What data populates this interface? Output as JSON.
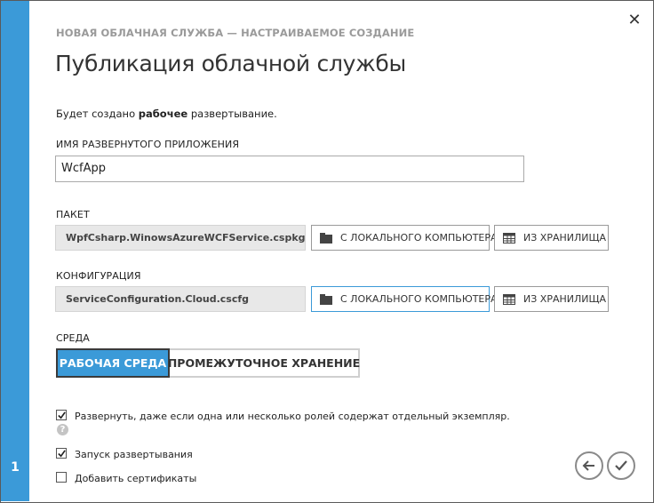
{
  "wizard": {
    "step": "1",
    "subtitle": "НОВАЯ ОБЛАЧНАЯ СЛУЖБА — НАСТРАИВАЕМОЕ СОЗДАНИЕ",
    "title": "Публикация облачной службы",
    "info_prefix": "Будет создано ",
    "info_bold": "рабочее",
    "info_suffix": " развертывание."
  },
  "app_name": {
    "label": "ИМЯ РАЗВЕРНУТОГО ПРИЛОЖЕНИЯ",
    "value": "WcfApp"
  },
  "package": {
    "label": "ПАКЕТ",
    "file": "WpfCsharp.WinowsAzureWCFService.cspkg",
    "local_button": "С ЛОКАЛЬНОГО КОМПЬЮТЕРА",
    "storage_button": "ИЗ ХРАНИЛИЩА"
  },
  "configuration": {
    "label": "КОНФИГУРАЦИЯ",
    "file": "ServiceConfiguration.Cloud.cscfg",
    "local_button": "С ЛОКАЛЬНОГО КОМПЬЮТЕРА",
    "storage_button": "ИЗ ХРАНИЛИЩА"
  },
  "environment": {
    "label": "СРЕДА",
    "production": "РАБОЧАЯ СРЕДА",
    "staging": "ПРОМЕЖУТОЧНОЕ ХРАНЕНИЕ",
    "selected": "РАБОЧАЯ СРЕДА"
  },
  "options": [
    {
      "label": "Развернуть, даже если одна или несколько ролей содержат отдельный экземпляр.",
      "checked": true
    },
    {
      "label": "Запуск развертывания",
      "checked": true
    },
    {
      "label": "Добавить сертификаты",
      "checked": false
    }
  ],
  "help_glyph": "?",
  "close_glyph": "✕",
  "colors": {
    "accent": "#3b9ad8",
    "subtitle": "#9a9a9a",
    "file_bg": "#e8e8e8"
  },
  "icons": {
    "close": "close-icon",
    "folder": "folder-icon",
    "storage": "storage-table-icon",
    "back": "arrow-left-icon",
    "finish": "checkmark-icon",
    "help": "help-icon"
  }
}
